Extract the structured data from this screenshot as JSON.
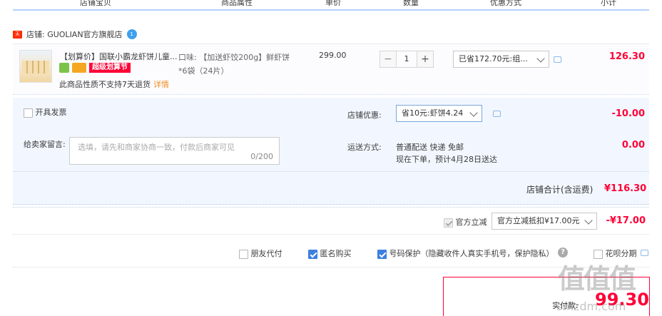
{
  "header": {
    "col_shop": "店铺宝贝",
    "col_attr": "商品属性",
    "col_price": "单价",
    "col_qty": "数量",
    "col_discount": "优惠方式",
    "col_subtotal": "小计"
  },
  "shop": {
    "flag": "天猫",
    "label": "店铺: GUOLIAN官方旗舰店",
    "badge": "1"
  },
  "item": {
    "title": "【划算价】国联小霸龙虾饼儿童...",
    "badge_promo": "超级划算节",
    "no_return": "此商品性质不支持7天退货",
    "no_return_link": "详情",
    "sku_line1": "口味: 【加送虾饺200g】鲜虾饼",
    "sku_line2": "*6袋（24片）",
    "price": "299.00",
    "qty": "1",
    "qty_minus": "−",
    "qty_plus": "+",
    "discount": "已省172.70元:组...",
    "subtotal": "126.30"
  },
  "options": {
    "invoice_label": "开具发票",
    "shop_discount_label": "店铺优惠:",
    "shop_discount_value": "省10元:虾饼4.24",
    "shop_discount_amount": "-10.00",
    "message_label": "给卖家留言:",
    "message_placeholder": "选填，请先和商家协商一致，付款后商家可见",
    "message_count": "0/200",
    "shipping_label": "运送方式:",
    "shipping_line1": "普通配送 快递 免邮",
    "shipping_line2": "现在下单，预计4月28日送达",
    "shipping_amount": "0.00",
    "shop_total_label": "店铺合计(含运费)",
    "shop_total_value": "¥116.30"
  },
  "official": {
    "label": "官方立减",
    "select": "官方立减抵扣¥17.00元",
    "amount": "-¥17.00"
  },
  "extras": {
    "friend_pay": "朋友代付",
    "anonymous": "匿名购买",
    "number_protect": "号码保护（隐藏收件人真实手机号，保护隐私）",
    "huabei": "花呗分期",
    "help": "?"
  },
  "payment": {
    "label": "实付款:",
    "amount": "99.30"
  },
  "watermark": {
    "big": "值值值",
    "site": "smzdm.com"
  }
}
